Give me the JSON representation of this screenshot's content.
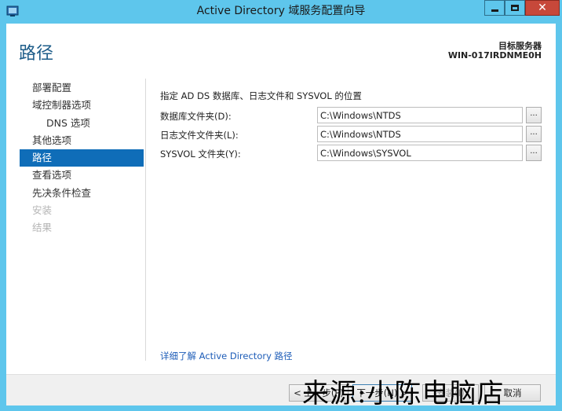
{
  "window": {
    "title": "Active Directory 域服务配置向导",
    "controls": {
      "minimize": "",
      "maximize": "",
      "close": "✕"
    }
  },
  "header": {
    "page_title": "路径",
    "target_label": "目标服务器",
    "target_name": "WIN-017IRDNME0H"
  },
  "nav": {
    "items": [
      {
        "label": "部署配置",
        "state": "normal"
      },
      {
        "label": "域控制器选项",
        "state": "normal"
      },
      {
        "label": "DNS 选项",
        "state": "sub"
      },
      {
        "label": "其他选项",
        "state": "normal"
      },
      {
        "label": "路径",
        "state": "active"
      },
      {
        "label": "查看选项",
        "state": "normal"
      },
      {
        "label": "先决条件检查",
        "state": "normal"
      },
      {
        "label": "安装",
        "state": "disabled"
      },
      {
        "label": "结果",
        "state": "disabled"
      }
    ]
  },
  "content": {
    "description": "指定 AD DS 数据库、日志文件和 SYSVOL 的位置",
    "fields": [
      {
        "label": "数据库文件夹(D):",
        "value": "C:\\Windows\\NTDS",
        "browse": "..."
      },
      {
        "label": "日志文件文件夹(L):",
        "value": "C:\\Windows\\NTDS",
        "browse": "..."
      },
      {
        "label": "SYSVOL 文件夹(Y):",
        "value": "C:\\Windows\\SYSVOL",
        "browse": "..."
      }
    ],
    "more_link": "详细了解 Active Directory 路径"
  },
  "footer": {
    "prev": "< 上一步(P)",
    "next": "下一步(N) >",
    "install": "安装(I)",
    "cancel": "取消"
  },
  "watermark": "来源:小陈电脑店"
}
